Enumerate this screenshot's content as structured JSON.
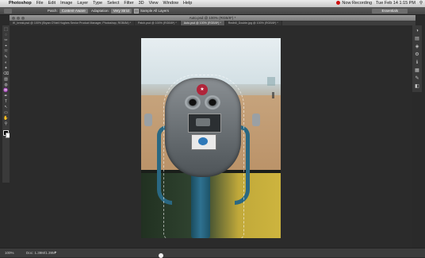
{
  "menubar": {
    "app_name": "Photoshop",
    "items": [
      "File",
      "Edit",
      "Image",
      "Layer",
      "Type",
      "Select",
      "Filter",
      "3D",
      "View",
      "Window",
      "Help"
    ],
    "recording_label": "Now Recording",
    "clock": "Tue Feb 14  1:15 PM"
  },
  "options_bar": {
    "patch_label": "Patch:",
    "patch_value": "Content-Aware",
    "adaptation_label": "Adaptation:",
    "adaptation_value": "Very Strict",
    "sample_all_layers_label": "Sample All Layers",
    "workspace_value": "Essentials"
  },
  "window_title": "Auto.psd @ 100% (RGB/8*) *",
  "tabs": [
    {
      "label": "IK_break.psd @ 100% (Bryan O'Neil Hughes Senior Product Manager, Photoshop, RGB/8#) *"
    },
    {
      "label": "Patch.psd @ 100% (RGB/8*) *"
    },
    {
      "label": "Auto.psd @ 100% (RGB/8*) *"
    },
    {
      "label": "Redhill_Double.jpg @ 100% (RGB/8*) *"
    }
  ],
  "active_tab_index": 2,
  "tools": [
    "⬚",
    "◌",
    "✂",
    "⌖",
    "⤧",
    "✎",
    "◐",
    "✦",
    "⌫",
    "▨",
    "◍",
    "♒",
    "✒",
    "T",
    "↖",
    "▭",
    "✋",
    "⚲"
  ],
  "panel_icons": [
    "◑",
    "▤",
    "◈",
    "⚙",
    "ℹ",
    "▦",
    "✎",
    "◧"
  ],
  "colors": {
    "foreground": "#000000",
    "background": "#ffffff"
  },
  "photo": {
    "emblem_text": "★"
  },
  "statusbar": {
    "zoom": "100%",
    "doc_size": "Doc: 1.39M/1.39M",
    "arrow": "▸"
  }
}
